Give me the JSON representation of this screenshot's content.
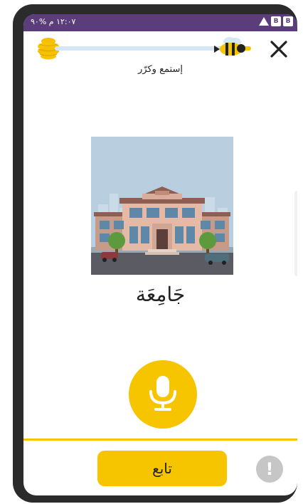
{
  "status_bar": {
    "left_text": "١٢:٠٧ م  %٩٠",
    "right_icons": [
      "alert-icon",
      "notification-icon",
      "notification-icon"
    ]
  },
  "lesson": {
    "progress_percent": 85,
    "instruction": "إستمع وكرّر",
    "word": "جَامِعَة",
    "image_subject": "university-building"
  },
  "footer": {
    "continue_label": "تابع",
    "report_icon": "!"
  },
  "colors": {
    "accent": "#f7c400",
    "status_bar": "#5a3d7a",
    "progress_track": "#d7e6f5"
  }
}
